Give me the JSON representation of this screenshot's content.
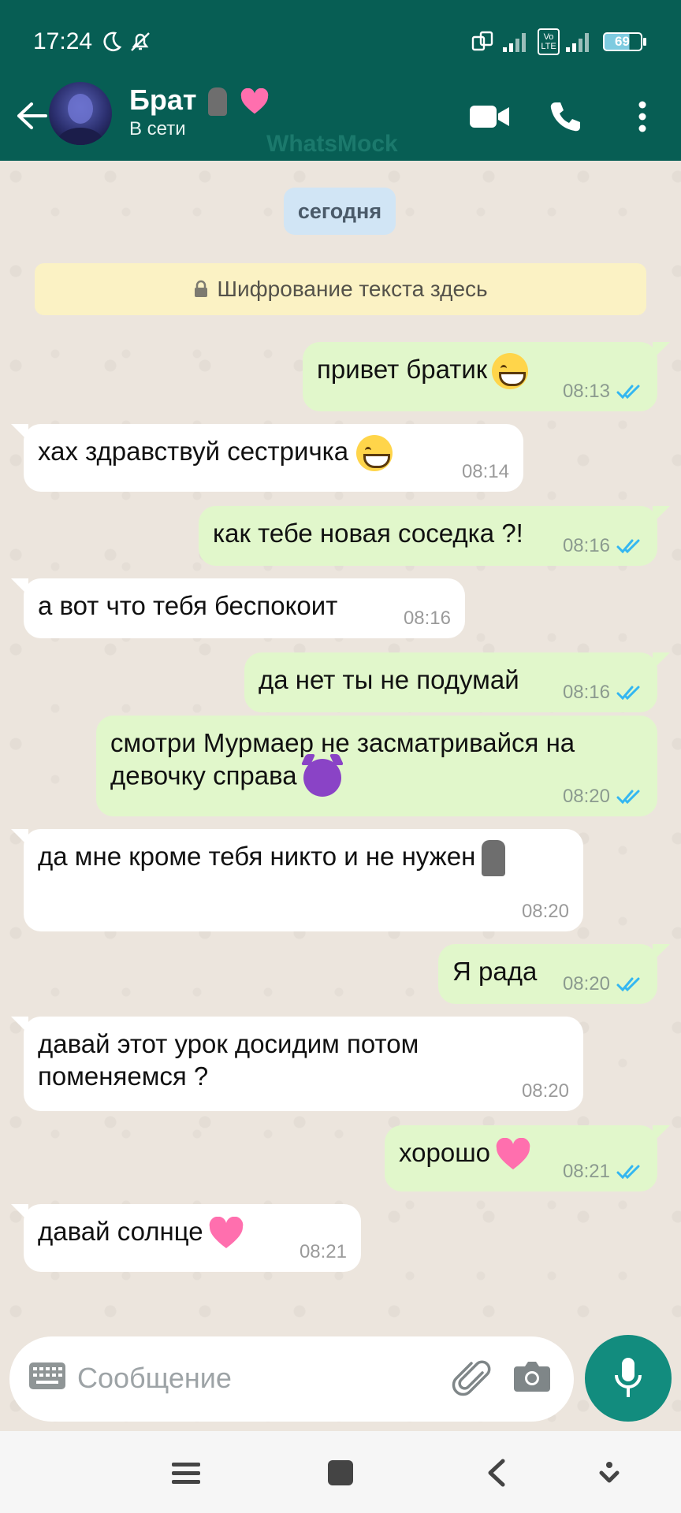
{
  "status_bar": {
    "time": "17:24",
    "battery": "69",
    "network_badge": "Vo LTE"
  },
  "header": {
    "contact_name": "Брат",
    "presence": "В сети",
    "watermark": "WhatsMock",
    "accent_color": "#075e54"
  },
  "chat": {
    "date_label": "сегодня",
    "encryption_text": "Шифрование текста здесь",
    "messages": [
      {
        "side": "out",
        "text": "привет братик",
        "time": "08:13",
        "emoji": "grin"
      },
      {
        "side": "in",
        "text": "хах здравствуй сестричка",
        "time": "08:14",
        "emoji": "grin"
      },
      {
        "side": "out",
        "text": "как тебе новая соседка ?!",
        "time": "08:16"
      },
      {
        "side": "in",
        "text": "а вот что тебя беспокоит",
        "time": "08:16"
      },
      {
        "side": "out",
        "text": "да нет ты не подумай",
        "time": "08:16"
      },
      {
        "side": "out",
        "text_line1": "смотри Мурмаер не засматривайся на",
        "text_line2": "девочку справа",
        "time": "08:20",
        "emoji": "devil"
      },
      {
        "side": "in",
        "text": "да мне кроме тебя никто и не нужен",
        "time": "08:20",
        "emoji": "moai"
      },
      {
        "side": "out",
        "text": "Я рада",
        "time": "08:20"
      },
      {
        "side": "in",
        "text_line1": "давай этот урок досидим  потом",
        "text_line2": "поменяемся ?",
        "time": "08:20"
      },
      {
        "side": "out",
        "text": "хорошо",
        "time": "08:21",
        "emoji": "heart"
      },
      {
        "side": "in",
        "text": "давай солнце",
        "time": "08:21",
        "emoji": "heart"
      }
    ],
    "colors": {
      "outgoing_bubble": "#e1f7cb",
      "incoming_bubble": "#ffffff",
      "read_tick": "#34b7f1"
    }
  },
  "composer": {
    "placeholder": "Сообщение"
  }
}
